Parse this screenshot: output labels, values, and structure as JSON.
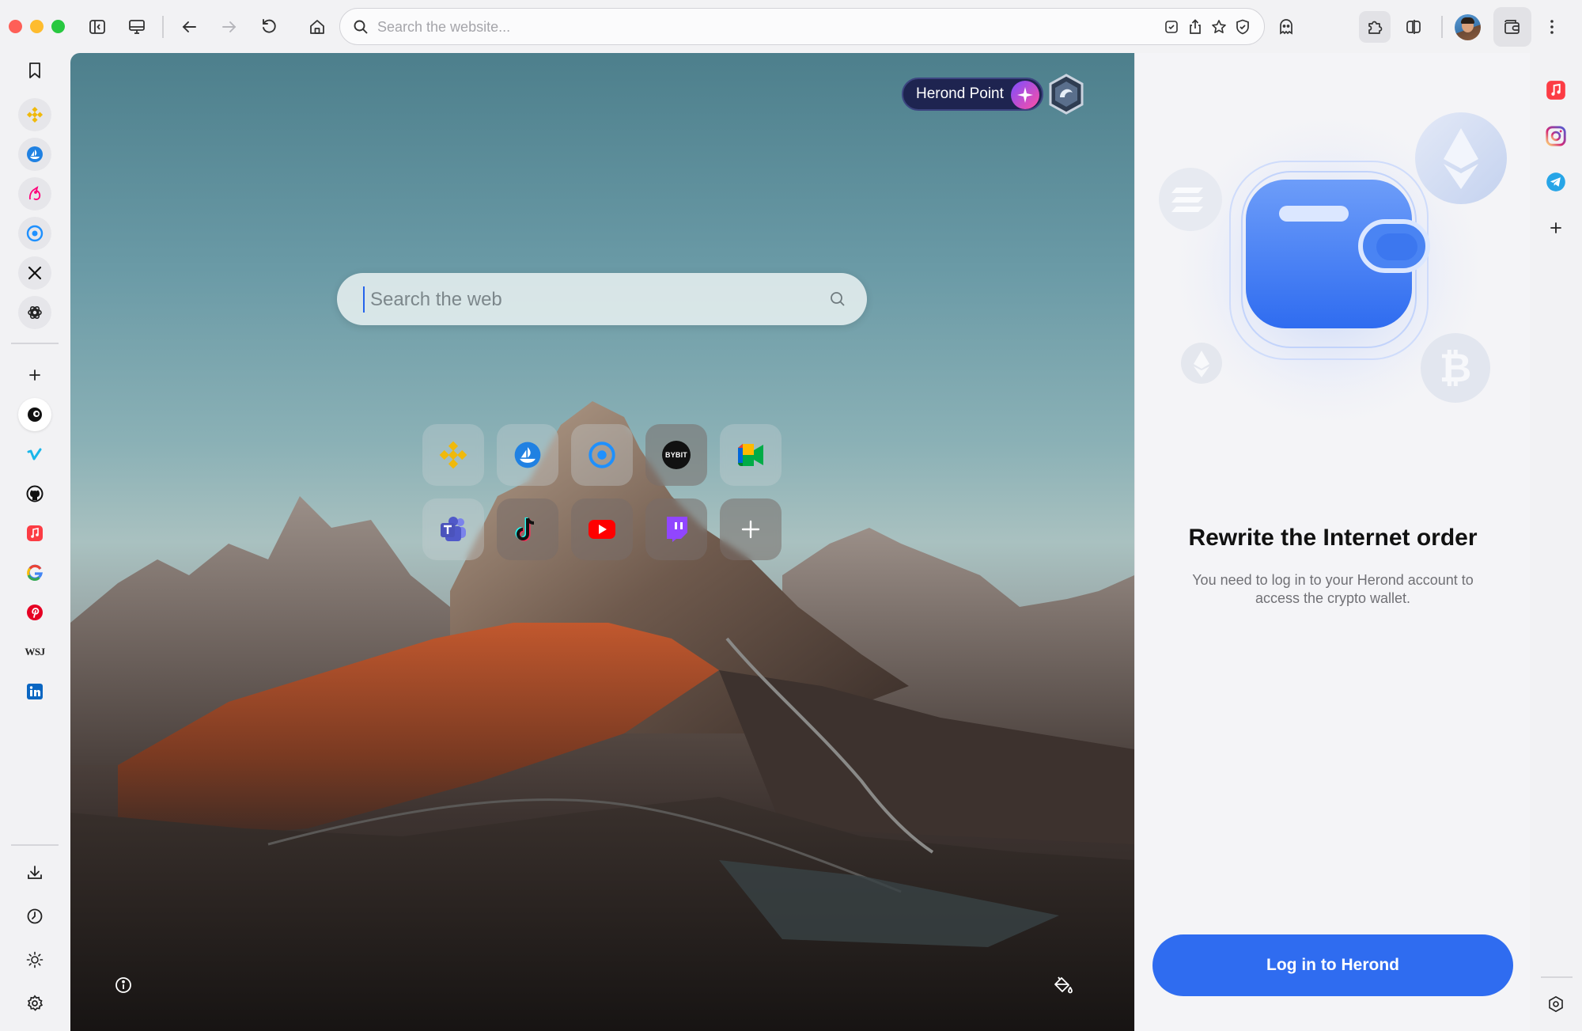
{
  "toolbar": {
    "url_placeholder": "Search the website..."
  },
  "newtab": {
    "herond_point_label": "Herond Point",
    "search_placeholder": "Search the web",
    "shortcuts": [
      {
        "name": "Binance",
        "icon": "binance-icon"
      },
      {
        "name": "OpenSea",
        "icon": "opensea-icon"
      },
      {
        "name": "CoinMarketCap",
        "icon": "coinmarketcap-icon"
      },
      {
        "name": "Bybit",
        "icon": "bybit-icon",
        "label": "BYBIT"
      },
      {
        "name": "Google Meet",
        "icon": "google-meet-icon"
      },
      {
        "name": "Microsoft Teams",
        "icon": "teams-icon"
      },
      {
        "name": "TikTok",
        "icon": "tiktok-icon"
      },
      {
        "name": "YouTube",
        "icon": "youtube-icon"
      },
      {
        "name": "Twitch",
        "icon": "twitch-icon"
      },
      {
        "name": "Add shortcut",
        "icon": "plus-icon"
      }
    ]
  },
  "wallet": {
    "title": "Rewrite the Internet order",
    "description": "You need to log in to your Herond account to access the crypto wallet.",
    "login_button": "Log in to Herond"
  },
  "left_sidebar": {
    "wsj_label": "WSJ"
  },
  "colors": {
    "accent": "#2f6cf0",
    "toolbar_bg": "#f2f2f4",
    "herond_point_bg": "#1e2450"
  }
}
